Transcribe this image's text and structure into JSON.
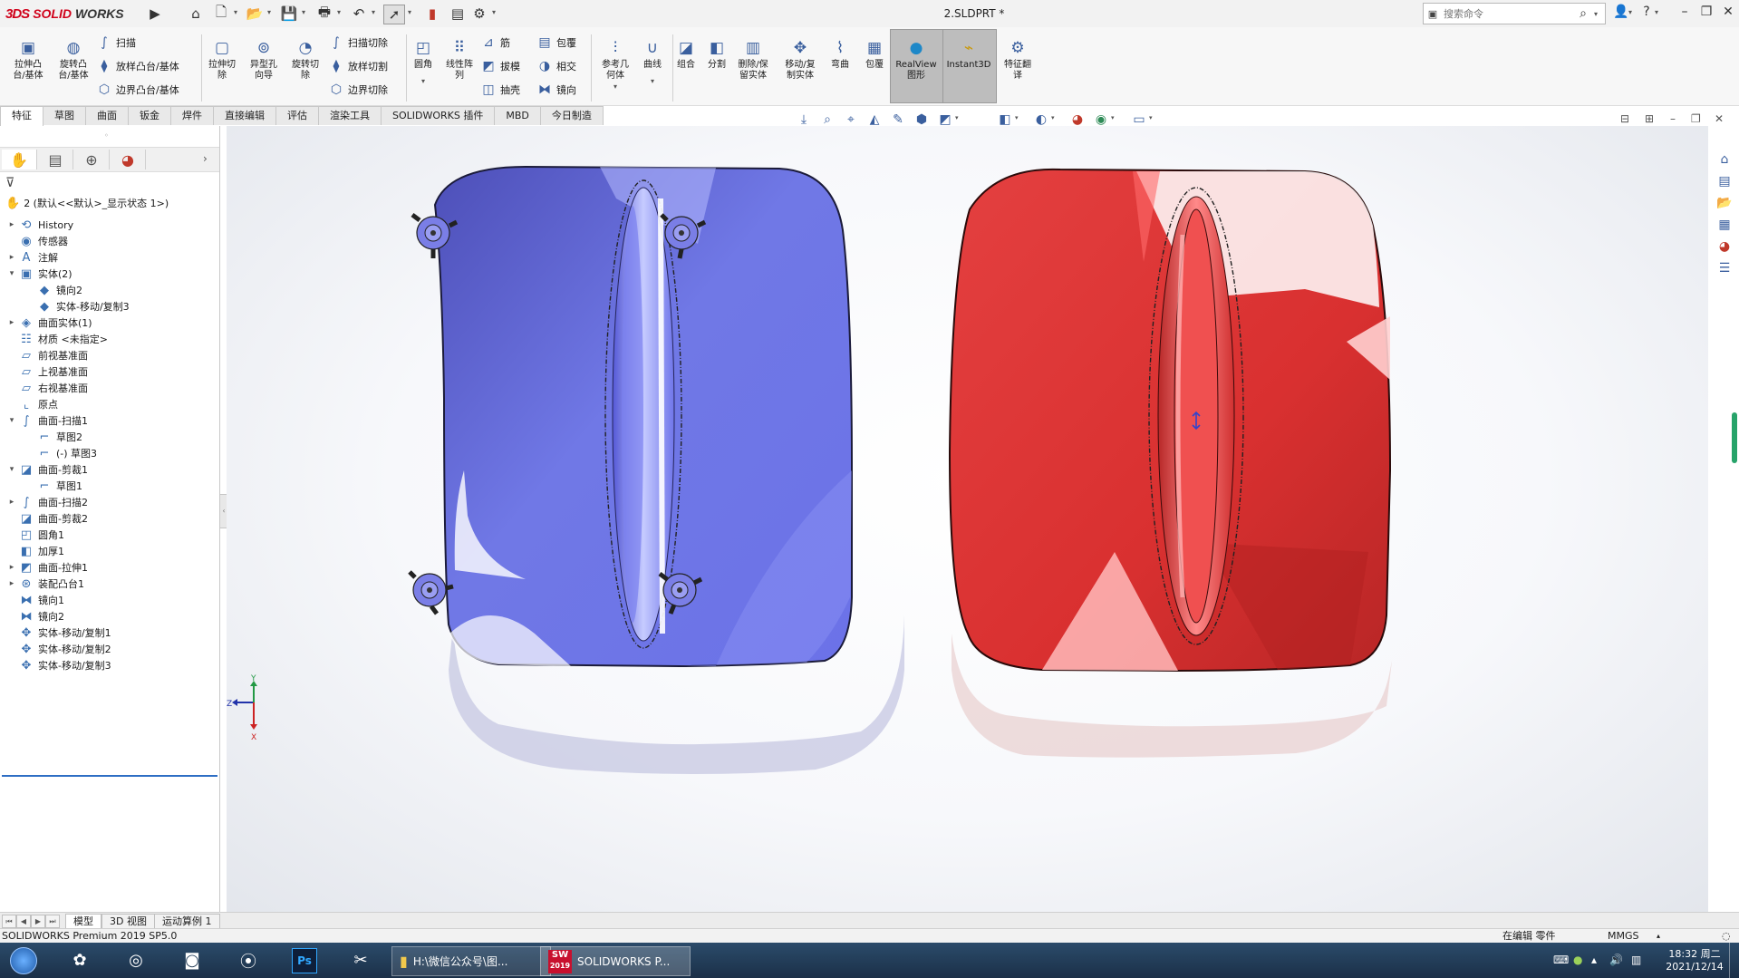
{
  "app": {
    "brand_ds": "3DS",
    "brand_solid": "SOLID",
    "brand_works": "WORKS",
    "document_title": "2.SLDPRT *"
  },
  "search": {
    "placeholder": "搜索命令"
  },
  "ribbon": {
    "extrude_boss": "拉伸凸\n台/基体",
    "revolve_boss": "旋转凸\n台/基体",
    "sweep": "扫描",
    "loft_boss": "放样凸台/基体",
    "boundary_boss": "边界凸台/基体",
    "extrude_cut": "拉伸切\n除",
    "hole_wizard": "异型孔\n向导",
    "revolve_cut": "旋转切\n除",
    "swept_cut": "扫描切除",
    "lofted_cut": "放样切割",
    "boundary_cut": "边界切除",
    "fillet": "圆角",
    "linear_pattern": "线性阵\n列",
    "rib": "筋",
    "draft": "拔模",
    "shell": "抽壳",
    "wrap": "包覆",
    "intersect": "相交",
    "mirror": "镜向",
    "ref_geometry": "参考几\n何体",
    "curves": "曲线",
    "combine": "组合",
    "split": "分割",
    "delete_keep_body": "删除/保\n留实体",
    "move_copy_body": "移动/复\n制实体",
    "flex": "弯曲",
    "wrap2": "包覆",
    "realview": "RealView\n图形",
    "instant3d": "Instant3D",
    "feature_translate": "特征翻\n译"
  },
  "tabs": [
    "特征",
    "草图",
    "曲面",
    "钣金",
    "焊件",
    "直接编辑",
    "评估",
    "渲染工具",
    "SOLIDWORKS 插件",
    "MBD",
    "今日制造"
  ],
  "tree": {
    "root": "2 (默认<<默认>_显示状态 1>)",
    "nodes": [
      {
        "label": "History",
        "icon": "history-icon",
        "indent": 0,
        "exp": "▸"
      },
      {
        "label": "传感器",
        "icon": "sensor-icon",
        "indent": 0,
        "exp": ""
      },
      {
        "label": "注解",
        "icon": "annotation-icon",
        "indent": 0,
        "exp": "▸"
      },
      {
        "label": "实体(2)",
        "icon": "solid-bodies-icon",
        "indent": 0,
        "exp": "▾"
      },
      {
        "label": "镜向2",
        "icon": "body-icon",
        "indent": 1,
        "exp": ""
      },
      {
        "label": "实体-移动/复制3",
        "icon": "body-icon",
        "indent": 1,
        "exp": ""
      },
      {
        "label": "曲面实体(1)",
        "icon": "surface-bodies-icon",
        "indent": 0,
        "exp": "▸"
      },
      {
        "label": "材质 <未指定>",
        "icon": "material-icon",
        "indent": 0,
        "exp": ""
      },
      {
        "label": "前视基准面",
        "icon": "plane-icon",
        "indent": 0,
        "exp": ""
      },
      {
        "label": "上视基准面",
        "icon": "plane-icon",
        "indent": 0,
        "exp": ""
      },
      {
        "label": "右视基准面",
        "icon": "plane-icon",
        "indent": 0,
        "exp": ""
      },
      {
        "label": "原点",
        "icon": "origin-icon",
        "indent": 0,
        "exp": ""
      },
      {
        "label": "曲面-扫描1",
        "icon": "surface-sweep-icon",
        "indent": 0,
        "exp": "▾"
      },
      {
        "label": "草图2",
        "icon": "sketch-icon",
        "indent": 1,
        "exp": ""
      },
      {
        "label": "(-) 草图3",
        "icon": "sketch-icon",
        "indent": 1,
        "exp": ""
      },
      {
        "label": "曲面-剪裁1",
        "icon": "surface-trim-icon",
        "indent": 0,
        "exp": "▾"
      },
      {
        "label": "草图1",
        "icon": "sketch-icon",
        "indent": 1,
        "exp": ""
      },
      {
        "label": "曲面-扫描2",
        "icon": "surface-sweep-icon",
        "indent": 0,
        "exp": "▸"
      },
      {
        "label": "曲面-剪裁2",
        "icon": "surface-trim-icon",
        "indent": 0,
        "exp": ""
      },
      {
        "label": "圆角1",
        "icon": "fillet-icon",
        "indent": 0,
        "exp": ""
      },
      {
        "label": "加厚1",
        "icon": "thicken-icon",
        "indent": 0,
        "exp": ""
      },
      {
        "label": "曲面-拉伸1",
        "icon": "surface-extrude-icon",
        "indent": 0,
        "exp": "▸"
      },
      {
        "label": "装配凸台1",
        "icon": "mounting-boss-icon",
        "indent": 0,
        "exp": "▸"
      },
      {
        "label": "镜向1",
        "icon": "mirror-icon",
        "indent": 0,
        "exp": ""
      },
      {
        "label": "镜向2",
        "icon": "mirror-icon",
        "indent": 0,
        "exp": ""
      },
      {
        "label": "实体-移动/复制1",
        "icon": "move-copy-icon",
        "indent": 0,
        "exp": ""
      },
      {
        "label": "实体-移动/复制2",
        "icon": "move-copy-icon",
        "indent": 0,
        "exp": ""
      },
      {
        "label": "实体-移动/复制3",
        "icon": "move-copy-icon",
        "indent": 0,
        "exp": ""
      }
    ]
  },
  "bottom_tabs": [
    "模型",
    "3D 视图",
    "运动算例 1"
  ],
  "status": {
    "product": "SOLIDWORKS Premium 2019 SP5.0",
    "mode": "在编辑 零件",
    "units": "MMGS"
  },
  "taskbar": {
    "explorer_window": "H:\\微信公众号\\图...",
    "sw_window": "SOLIDWORKS P...",
    "ps_label": "Ps",
    "sw_badge": "SW",
    "sw_year": "2019",
    "time": "18:32 周二",
    "date": "2021/12/14"
  },
  "triad": {
    "z": "Z",
    "y": "Y",
    "x": "X"
  },
  "colors": {
    "blue_body": "#6b6fe0",
    "red_body": "#e03a3a",
    "accent": "#2e6ec4"
  }
}
